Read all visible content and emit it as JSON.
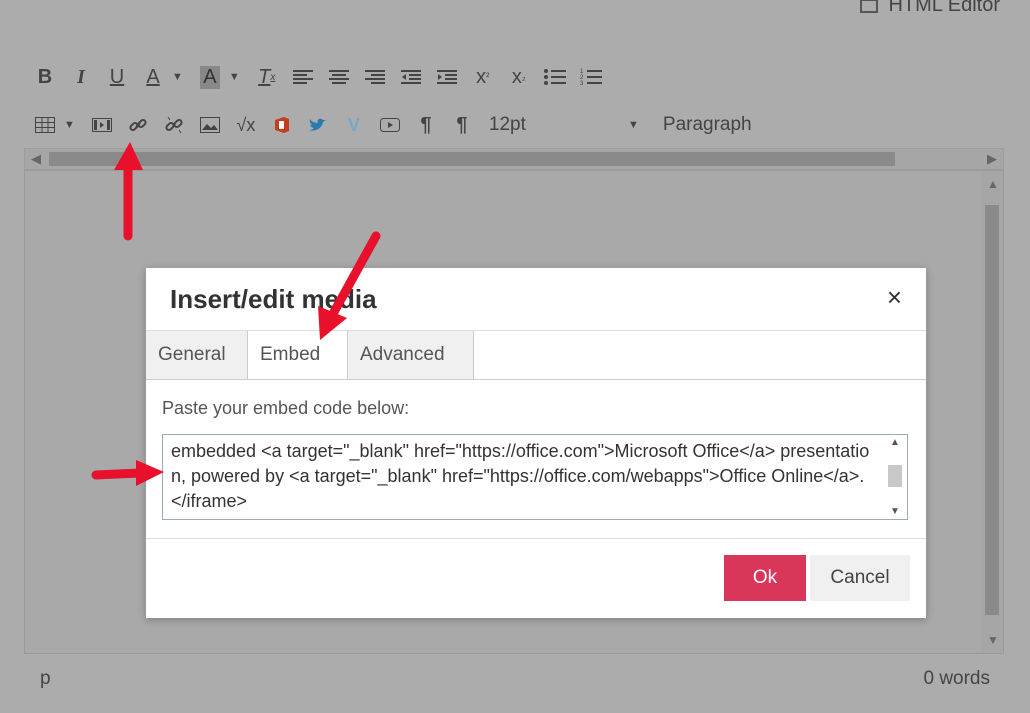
{
  "header": {
    "title": "HTML Editor"
  },
  "toolbar": {
    "row1": [
      "bold-icon",
      "italic-icon",
      "underline-icon",
      "text-color-icon",
      "background-color-icon",
      "clear-formatting-icon",
      "align-left-icon",
      "align-center-icon",
      "align-right-icon",
      "outdent-icon",
      "indent-icon",
      "superscript-icon",
      "subscript-icon",
      "bullet-list-icon",
      "numbered-list-icon"
    ],
    "row2": [
      "table-icon",
      "media-icon",
      "link-icon",
      "unlink-icon",
      "image-icon",
      "equation-icon",
      "office-icon",
      "twitter-icon",
      "vimeo-icon",
      "youtube-icon",
      "ltr-icon",
      "rtl-icon"
    ],
    "font_size": "12pt",
    "format": "Paragraph"
  },
  "dialog": {
    "title": "Insert/edit media",
    "close": "×",
    "tabs": [
      {
        "label": "General",
        "active": false
      },
      {
        "label": "Embed",
        "active": true
      },
      {
        "label": "Advanced",
        "active": false
      }
    ],
    "paste_label": "Paste your embed code below:",
    "embed_code": "embedded <a target=\"_blank\" href=\"https://office.com\">Microsoft Office</a> presentation, powered by <a target=\"_blank\" href=\"https://office.com/webapps\">Office Online</a>.</iframe>",
    "ok_label": "Ok",
    "cancel_label": "Cancel"
  },
  "status": {
    "path": "p",
    "word_count": "0 words"
  },
  "colors": {
    "ok": "#d9365a",
    "arrow": "#e8102a",
    "overlay": "#acacac"
  }
}
